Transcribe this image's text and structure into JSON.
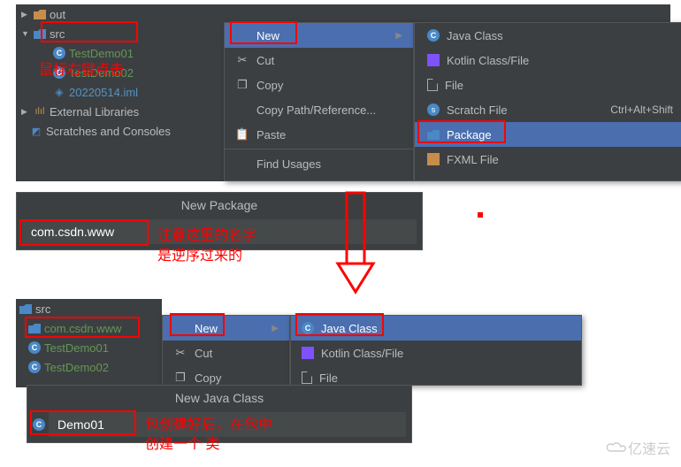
{
  "panel1": {
    "tree": {
      "out": "out",
      "src": "src",
      "testdemo01": "TestDemo01",
      "testdemo02": "TestDemo02",
      "iml": "20220514.iml",
      "extlib": "External Libraries",
      "scratches": "Scratches and Consoles"
    },
    "annotation_rightclick": "鼠标右键点击",
    "ctx": {
      "new": "New",
      "cut": "Cut",
      "copy": "Copy",
      "copypath": "Copy Path/Reference...",
      "paste": "Paste",
      "findusages": "Find Usages"
    },
    "sub": {
      "javaclass": "Java Class",
      "kotlin": "Kotlin Class/File",
      "file": "File",
      "scratchfile": "Scratch File",
      "scratch_shortcut": "Ctrl+Alt+Shift",
      "package": "Package",
      "fxml": "FXML File"
    }
  },
  "dialog_newpackage": {
    "title": "New Package",
    "input_value": "com.csdn.www",
    "annotation_line1": "注意这里的名字",
    "annotation_line2": "是逆序过来的"
  },
  "panel3": {
    "tree": {
      "src": "src",
      "pkg": "com.csdn.www",
      "testdemo01": "TestDemo01",
      "testdemo02": "TestDemo02"
    },
    "ctx": {
      "new": "New",
      "cut": "Cut",
      "copy": "Copy"
    },
    "sub": {
      "javaclass": "Java Class",
      "kotlin": "Kotlin Class/File",
      "file": "File"
    }
  },
  "dialog_newclass": {
    "title": "New Java Class",
    "input_value": "Demo01",
    "annotation_line1": "包创建好后，在包中",
    "annotation_line2": "创建一个 类"
  },
  "watermark": "亿速云"
}
